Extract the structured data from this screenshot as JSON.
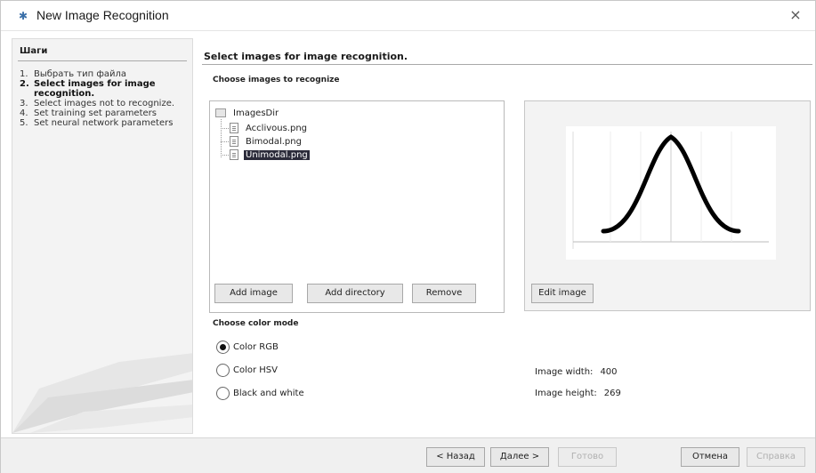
{
  "window": {
    "title": "New Image Recognition",
    "close_glyph": "×"
  },
  "steps": {
    "header": "Шаги",
    "items": [
      {
        "num": "1.",
        "label": "Выбрать тип файла"
      },
      {
        "num": "2.",
        "label": "Select images for image recognition."
      },
      {
        "num": "3.",
        "label": "Select images not to recognize."
      },
      {
        "num": "4.",
        "label": "Set training set parameters"
      },
      {
        "num": "5.",
        "label": "Set neural network parameters"
      }
    ],
    "current_index": 1
  },
  "main": {
    "title": "Select images for image recognition.",
    "choose_label": "Choose images to recognize",
    "tree": {
      "root": "ImagesDir",
      "files": [
        "Acclivous.png",
        "Bimodal.png",
        "Unimodal.png"
      ],
      "selected": "Unimodal.png"
    },
    "buttons": {
      "add_image": "Add image",
      "add_directory": "Add directory",
      "remove": "Remove",
      "edit_image": "Edit image"
    },
    "color_mode": {
      "label": "Choose color mode",
      "options": [
        "Color RGB",
        "Color HSV",
        "Black and white"
      ],
      "selected": "Color RGB"
    },
    "image_info": {
      "width_label": "Image width:",
      "width_value": "400",
      "height_label": "Image height:",
      "height_value": "269"
    }
  },
  "footer": {
    "back": "< Назад",
    "next": "Далее >",
    "finish": "Готово",
    "cancel": "Отмена",
    "help": "Справка"
  },
  "icons": {
    "title": "wizard-icon",
    "close": "close-icon",
    "folder": "folder-icon",
    "file": "file-icon"
  },
  "colors": {
    "selection": "#2b2b3a",
    "panel": "#f3f3f3"
  }
}
